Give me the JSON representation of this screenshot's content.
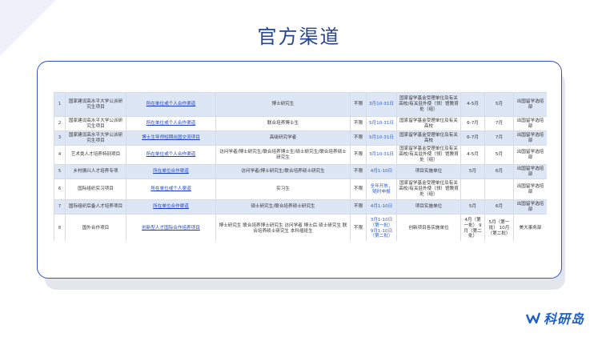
{
  "title": "官方渠道",
  "logo_text": "科研岛",
  "rows": [
    {
      "no": "1",
      "name": "国家建设高水平大学公派研究生项目",
      "channel": "所在单位或个人合作渠道",
      "category": "博士研究生",
      "limit": "不限",
      "date": "3月10-31日",
      "unit": "国家留学基金受理单位及有关高校/有关驻外使（领）馆教育处（组）",
      "c8": "4-5月",
      "c9": "5月",
      "c10": "出国留学选培部",
      "shade": true
    },
    {
      "no": "2",
      "name": "国家建设高水平大学公派研究生项目",
      "channel": "所在单位或个人合作渠道",
      "category": "联合培养博士生",
      "limit": "不限",
      "date": "5月10-31日",
      "unit": "国家留学基金受理单位及有关高校",
      "c8": "6-7月",
      "c9": "7月",
      "c10": "出国留学选培部",
      "shade": false
    },
    {
      "no": "3",
      "name": "国家建设高水平大学公派研究生项目",
      "channel": "博士生导师短期出国交流项目",
      "category": "高级研究学者",
      "limit": "不限",
      "date": "5月10-31日",
      "unit": "国家留学基金受理单位及有关高校",
      "c8": "6-7月",
      "c9": "7月",
      "c10": "出国留学选培部",
      "shade": true
    },
    {
      "no": "4",
      "name": "艺术类人才培养特别项目",
      "channel": "所在单位或个人合作渠道",
      "category": "访问学者/博士研究生/联合培养博士生/硕士研究生/联合培养硕士研究生",
      "limit": "不限",
      "date": "3月10-31日",
      "unit": "国家留学基金受理单位及有关高校/有关驻外使（领）馆教育处（组）",
      "c8": "4-5月",
      "c9": "5月",
      "c10": "出国留学选培部",
      "shade": false
    },
    {
      "no": "5",
      "name": "乡村振兴人才培养专项",
      "channel": "所在单位合作渠道",
      "category": "访问学者/博士研究生/联合培养硕士研究生",
      "limit": "不限",
      "date": "4月1-10日",
      "unit": "项目实施单位",
      "c8": "5月",
      "c9": "6月",
      "c10": "出国留学选培部",
      "shade": true
    },
    {
      "no": "6",
      "name": "国际组织实习项目",
      "channel": "所在单位或个人渠道",
      "category": "实习生",
      "limit": "不限",
      "date": "全年开放，随时申报",
      "unit": "国家留学基金受理单位及有关高校/有关驻外使（领）馆教育处（组）",
      "c8": "",
      "c9": "",
      "c10": "出国留学选培部",
      "shade": false
    },
    {
      "no": "7",
      "name": "国际组织后备人才培养项目",
      "channel": "所在单位合作渠道",
      "category": "硕士研究生/联合培养硕士研究生",
      "limit": "不限",
      "date": "4月1-10日",
      "unit": "项目实施单位",
      "c8": "5月",
      "c9": "6月",
      "c10": "出国留学选培部",
      "shade": true
    },
    {
      "no": "8",
      "name": "国外合作项目",
      "channel": "创新型人才国际合作培养项目",
      "category": "博士研究生 联合培养博士研究生 访问学者 博士后 硕士研究生 联合培养硕士研究生 本科插班生",
      "limit": "不限",
      "date": "3月1-10日（第一批） 9月1-10日（第二批）",
      "unit": "创新项目各实施单位",
      "c8": "4月（第一批） 9月（第二批）",
      "c9": "5月（第一批） 10月（第二批）",
      "c10": "美大事务部",
      "shade": false
    }
  ]
}
